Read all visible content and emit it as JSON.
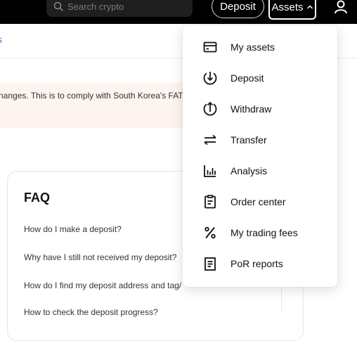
{
  "header": {
    "search_placeholder": "Search crypto",
    "deposit_label": "Deposit",
    "assets_label": "Assets"
  },
  "page": {
    "subnav_tab": "s",
    "notice_text": "nanges. This is to comply with South Korea's FATF",
    "faq": {
      "title": "FAQ",
      "questions": [
        "How do I make a deposit?",
        "Why have I still not received my deposit?",
        "How do I find my deposit address and tag/",
        "How to check the deposit progress?"
      ]
    }
  },
  "assets_menu": {
    "items": [
      {
        "label": "My assets",
        "icon": "wallet-icon"
      },
      {
        "label": "Deposit",
        "icon": "deposit-arrow-icon"
      },
      {
        "label": "Withdraw",
        "icon": "withdraw-arrow-icon"
      },
      {
        "label": "Transfer",
        "icon": "transfer-icon"
      },
      {
        "label": "Analysis",
        "icon": "bar-chart-icon"
      },
      {
        "label": "Order center",
        "icon": "clipboard-icon"
      },
      {
        "label": "My trading fees",
        "icon": "percent-icon"
      },
      {
        "label": "PoR reports",
        "icon": "report-icon"
      }
    ]
  },
  "colors": {
    "topbar": "#000000",
    "notice_bg": "#fdf3ef",
    "link": "#5a74d8"
  }
}
